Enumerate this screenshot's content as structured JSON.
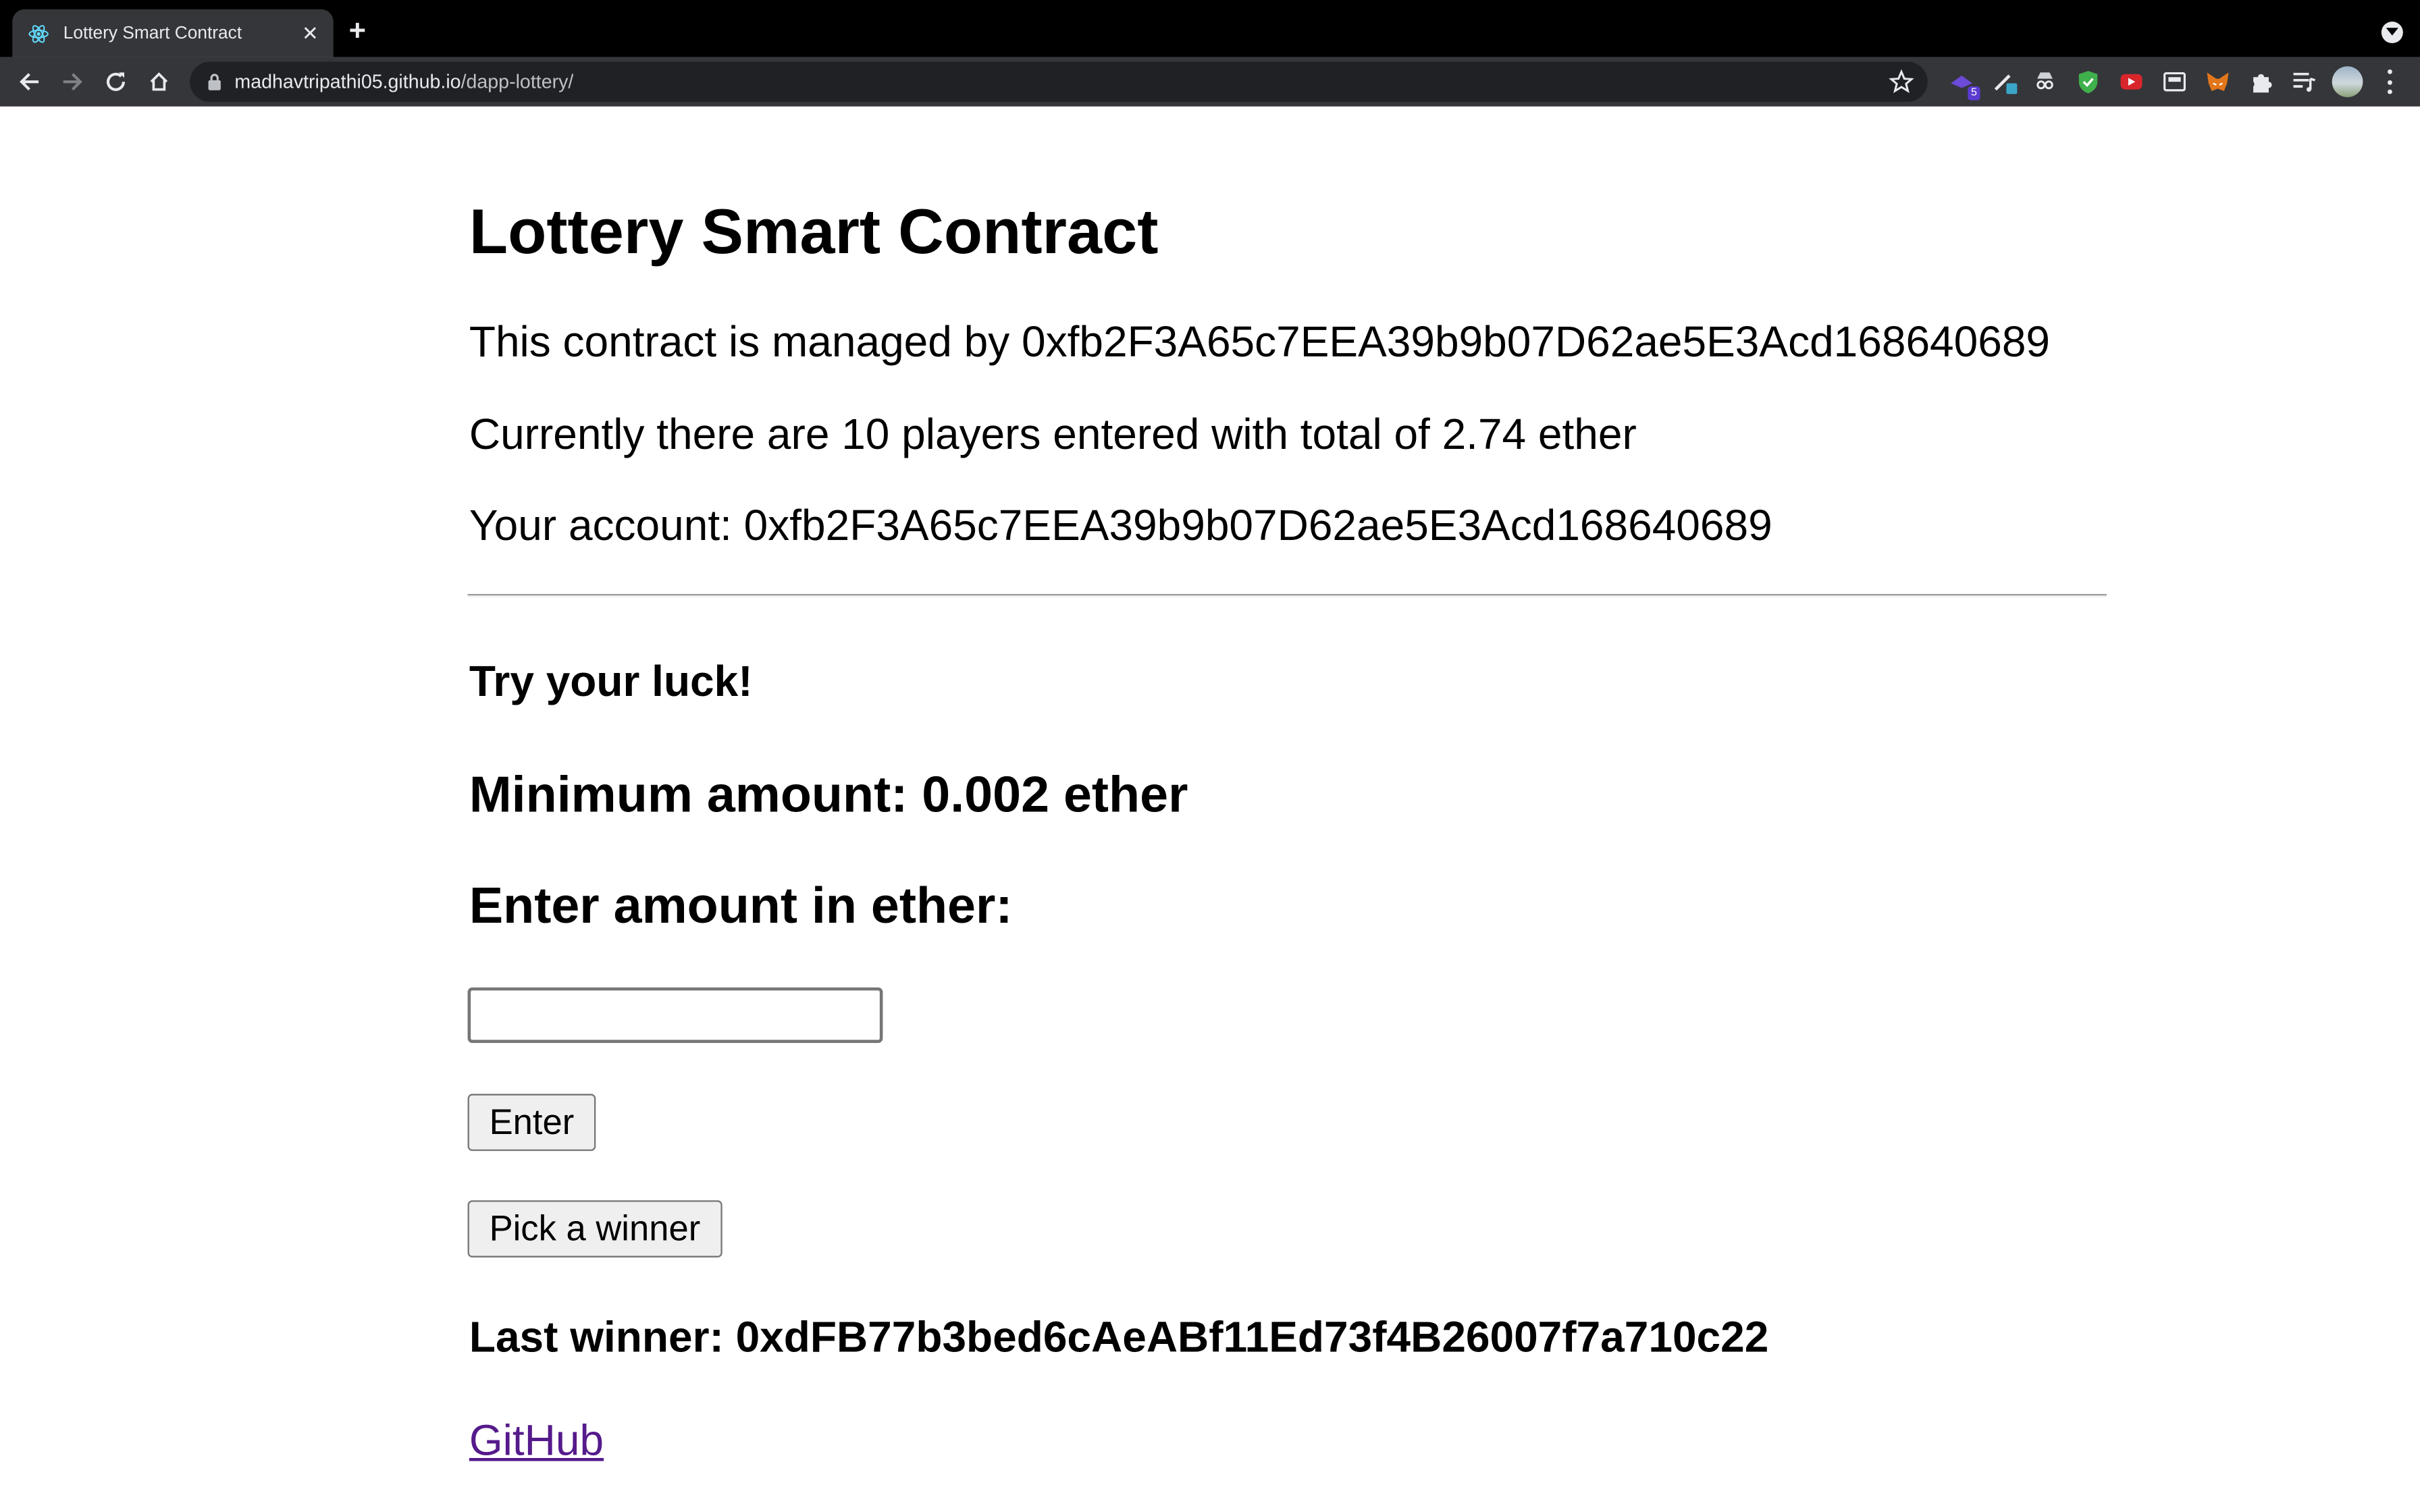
{
  "browser": {
    "tab_title": "Lottery Smart Contract",
    "url_host": "madhavtripathi05.github.io",
    "url_path": "/dapp-lottery/",
    "extension_badge": "5"
  },
  "page": {
    "heading": "Lottery Smart Contract",
    "manager_line": "This contract is managed by 0xfb2F3A65c7EEA39b9b07D62ae5E3Acd168640689",
    "players_line": "Currently there are 10 players entered with total of 2.74 ether",
    "account_line": "Your account: 0xfb2F3A65c7EEA39b9b07D62ae5E3Acd168640689",
    "try_luck": "Try your luck!",
    "minimum_amount": "Minimum amount: 0.002 ether",
    "enter_amount_label": "Enter amount in ether:",
    "amount_input_value": "",
    "enter_button": "Enter",
    "pick_winner_button": "Pick a winner",
    "last_winner": "Last winner: 0xdFB77b3bed6cAeABf11Ed73f4B26007f7a710c22",
    "github_link": "GitHub"
  }
}
